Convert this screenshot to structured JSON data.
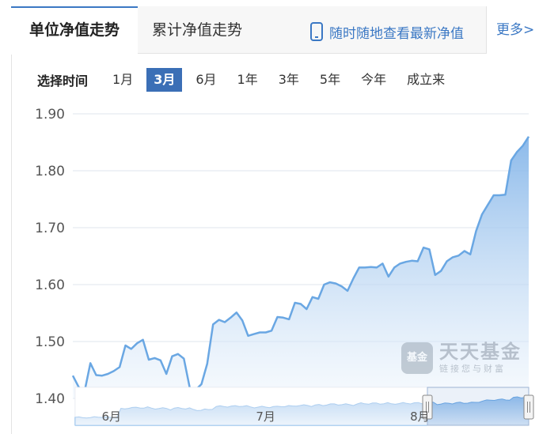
{
  "tabs": {
    "active": "单位净值走势",
    "second": "累计净值走势",
    "mobile": "随时随地查看最新净值",
    "more": "更多>"
  },
  "range": {
    "label": "选择时间",
    "options": [
      "1月",
      "3月",
      "6月",
      "1年",
      "3年",
      "5年",
      "今年",
      "成立来"
    ],
    "selected": "3月"
  },
  "watermark": {
    "seal": "基金",
    "title": "天天基金",
    "subtitle": "链接您与财富"
  },
  "colors": {
    "line": "#6aa7e3",
    "fill_top": "#7fb2e8",
    "fill_bottom": "#eef5fc",
    "grid": "#dfe4ee",
    "accent": "#3b6fb6"
  },
  "chart_data": {
    "type": "area",
    "title": "",
    "xlabel": "",
    "ylabel": "",
    "ylim": [
      1.4,
      1.9
    ],
    "yticks": [
      "1.40",
      "1.50",
      "1.60",
      "1.70",
      "1.80",
      "1.90"
    ],
    "grid": true,
    "navigator_labels": [
      {
        "label": "6月",
        "t": 0.045
      },
      {
        "label": "7月",
        "t": 0.385
      },
      {
        "label": "8月",
        "t": 0.725
      }
    ],
    "series": [
      {
        "values": [
          1.44,
          1.42,
          1.412,
          1.462,
          1.441,
          1.44,
          1.443,
          1.448,
          1.455,
          1.493,
          1.487,
          1.497,
          1.503,
          1.468,
          1.471,
          1.467,
          1.443,
          1.474,
          1.478,
          1.47,
          1.419,
          1.415,
          1.425,
          1.461,
          1.53,
          1.538,
          1.534,
          1.542,
          1.551,
          1.537,
          1.51,
          1.513,
          1.516,
          1.516,
          1.519,
          1.543,
          1.542,
          1.539,
          1.568,
          1.566,
          1.557,
          1.578,
          1.575,
          1.6,
          1.604,
          1.602,
          1.597,
          1.589,
          1.611,
          1.63,
          1.63,
          1.631,
          1.63,
          1.637,
          1.614,
          1.63,
          1.637,
          1.64,
          1.642,
          1.641,
          1.665,
          1.662,
          1.617,
          1.624,
          1.641,
          1.648,
          1.651,
          1.659,
          1.653,
          1.694,
          1.723,
          1.74,
          1.757,
          1.757,
          1.758,
          1.818,
          1.833,
          1.844,
          1.86
        ]
      }
    ]
  }
}
